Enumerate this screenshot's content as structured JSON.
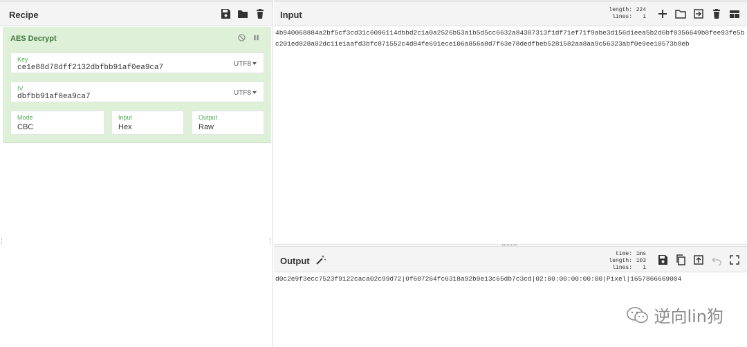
{
  "recipe": {
    "title": "Recipe",
    "icons": [
      "save-icon",
      "folder-icon",
      "trash-icon"
    ],
    "operation": {
      "name": "AES Decrypt",
      "controls": [
        "disable-icon",
        "pause-icon"
      ],
      "key": {
        "label": "Key",
        "value": "ce1e88d78dff2132dbfbb91af0ea9ca7",
        "encoding": "UTF8"
      },
      "iv": {
        "label": "IV",
        "value": "dbfbb91af0ea9ca7",
        "encoding": "UTF8"
      },
      "mode": {
        "label": "Mode",
        "value": "CBC"
      },
      "input": {
        "label": "Input",
        "value": "Hex"
      },
      "output": {
        "label": "Output",
        "value": "Raw"
      }
    }
  },
  "input": {
    "title": "Input",
    "length_label": "length:",
    "length": "224",
    "lines_label": "lines:",
    "lines": "1",
    "icons": [
      "plus-icon",
      "folder-icon",
      "import-icon",
      "trash-icon",
      "layout-icon"
    ],
    "text": "4b940068884a2bf5cf3cd31c6096114dbbd2c1a0a2526b53a1b5d5cc6632a84387313f1df71ef71f9abe3d156d1eea5b2d6bf0356649b8fee93fe5bc201ed828a02dc11e1aafd3bfc871552c4d84fe691ece106a856a8d7f63e78dedfbeb5281582aa8aa9c56323abf0e9ee10573b8eb"
  },
  "output": {
    "title": "Output",
    "time_label": "time:",
    "time": "1ms",
    "length_label": "length:",
    "length": "103",
    "lines_label": "lines:",
    "lines": "1",
    "icons": [
      "magic-wand-icon",
      "save-icon",
      "copy-icon",
      "replace-input-icon",
      "undo-icon",
      "maximize-icon"
    ],
    "text": "d0c2e9f3ecc7523f9122caca02c99d72|0f607264fc6318a92b9e13c65db7c3cd|02:00:00:00:00:00|Pixel|1657866669004"
  },
  "watermark": {
    "text": "逆向lin狗"
  }
}
